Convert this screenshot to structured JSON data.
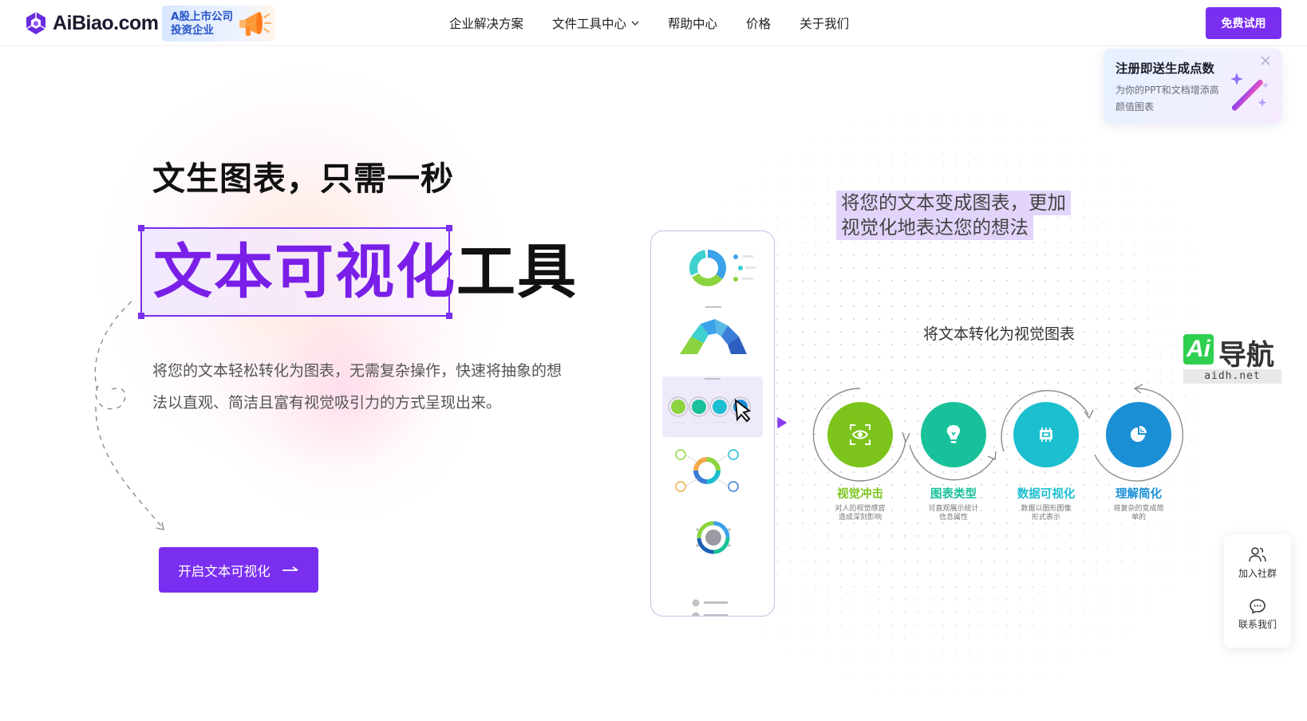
{
  "header": {
    "logo_text": "AiBiao.com",
    "badge_line1": "A股上市公司",
    "badge_line2": "投资企业",
    "nav": [
      {
        "label": "企业解决方案"
      },
      {
        "label": "文件工具中心"
      },
      {
        "label": "帮助中心"
      },
      {
        "label": "价格"
      },
      {
        "label": "关于我们"
      }
    ],
    "trial_button": "免费试用"
  },
  "promo": {
    "title": "注册即送生成点数",
    "description": "为你的PPT和文档增添高颜值图表"
  },
  "hero": {
    "title": "文生图表，只需一秒",
    "highlight": "文本可视化",
    "suffix": "工具",
    "description": "将您的文本轻松转化为图表，无需复杂操作，快速将抽象的想法以直观、简洁且富有视觉吸引力的方式呈现出来。",
    "cta": "开启文本可视化"
  },
  "showcase": {
    "quote_line1": "将您的文本变成图表，更加",
    "quote_line2": "视觉化地表达您的想法",
    "diagram_title": "将文本转化为视觉图表",
    "steps": [
      {
        "label": "视觉冲击",
        "desc_line1": "对人的视觉感官",
        "desc_line2": "造成深刻影响",
        "color": "#7cc41c"
      },
      {
        "label": "图表类型",
        "desc_line1": "可直观展示统计",
        "desc_line2": "信息属性",
        "color": "#19c19a"
      },
      {
        "label": "数据可视化",
        "desc_line1": "数据以图形图像",
        "desc_line2": "形式表示",
        "color": "#1bbfd0"
      },
      {
        "label": "理解简化",
        "desc_line1": "将复杂的变成简",
        "desc_line2": "单的",
        "color": "#1a8fd6"
      }
    ]
  },
  "watermark": {
    "ai": "Ai",
    "name": "导航",
    "url": "aidh.net"
  },
  "side_widget": {
    "community": "加入社群",
    "contact": "联系我们"
  }
}
